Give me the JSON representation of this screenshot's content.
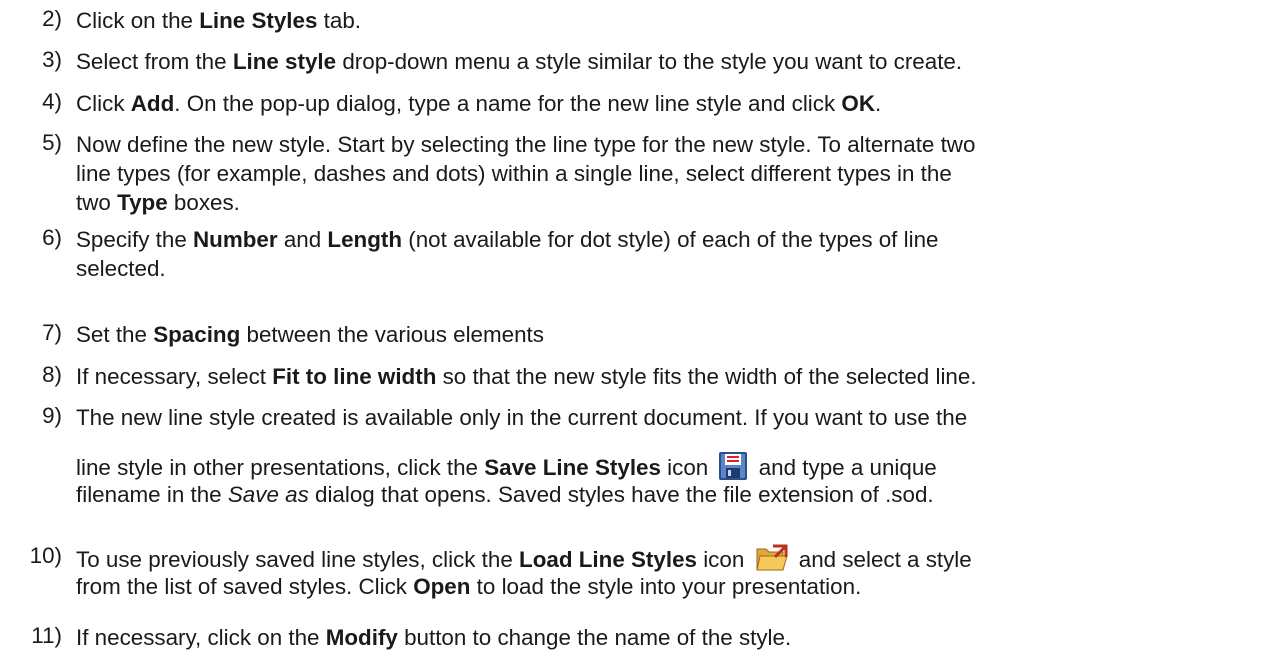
{
  "steps": [
    {
      "num": "2)",
      "lines": [
        [
          {
            "t": "Click on the "
          },
          {
            "t": "Line Styles",
            "b": true
          },
          {
            "t": " tab."
          }
        ]
      ]
    },
    {
      "num": "3)",
      "lines": [
        [
          {
            "t": "Select from the "
          },
          {
            "t": "Line style",
            "b": true
          },
          {
            "t": " drop-down menu a style similar to the style you want to create."
          }
        ]
      ]
    },
    {
      "num": "4)",
      "lines": [
        [
          {
            "t": "Click "
          },
          {
            "t": "Add",
            "b": true
          },
          {
            "t": ". On the pop-up dialog, type a name for the new line style and click "
          },
          {
            "t": "OK",
            "b": true
          },
          {
            "t": "."
          }
        ]
      ]
    },
    {
      "num": "5)",
      "lines": [
        [
          {
            "t": "Now define the new style. Start by selecting the line type for the new style. To alternate two"
          }
        ],
        [
          {
            "t": "line types (for example, dashes and dots) within a single line, select different types in the"
          }
        ],
        [
          {
            "t": "two "
          },
          {
            "t": "Type",
            "b": true
          },
          {
            "t": " boxes."
          }
        ]
      ]
    },
    {
      "num": "6)",
      "lines": [
        [
          {
            "t": "Specify the "
          },
          {
            "t": "Number",
            "b": true
          },
          {
            "t": " and "
          },
          {
            "t": "Length",
            "b": true
          },
          {
            "t": " (not available for dot style) of each of the types of line"
          }
        ],
        [
          {
            "t": "selected."
          }
        ]
      ]
    },
    {
      "num": "7)",
      "lines": [
        [
          {
            "t": "Set the "
          },
          {
            "t": "Spacing",
            "b": true
          },
          {
            "t": " between the various elements"
          }
        ]
      ]
    },
    {
      "num": "8)",
      "lines": [
        [
          {
            "t": "If necessary, select "
          },
          {
            "t": "Fit to line width",
            "b": true
          },
          {
            "t": " so that the new style fits the width of the selected line."
          }
        ]
      ]
    },
    {
      "num": "9)",
      "lines": [
        [
          {
            "t": "The new line style created is available only in the current document. If you want to use the"
          }
        ],
        [
          {
            "t": "line style in other presentations, click the "
          },
          {
            "t": "Save Line Styles",
            "b": true
          },
          {
            "t": " icon "
          },
          {
            "icon": "save-icon"
          },
          {
            "t": " and type a unique"
          }
        ],
        [
          {
            "t": "filename in the "
          },
          {
            "t": "Save as",
            "i": true
          },
          {
            "t": " dialog that opens. Saved styles have the file extension of .sod."
          }
        ]
      ]
    },
    {
      "num": "10)",
      "lines": [
        [
          {
            "t": "To use previously saved line styles, click the "
          },
          {
            "t": "Load Line Styles",
            "b": true
          },
          {
            "t": " icon "
          },
          {
            "icon": "open-folder-icon"
          },
          {
            "t": " and select a style"
          }
        ],
        [
          {
            "t": "from the list of saved styles. Click "
          },
          {
            "t": "Open",
            "b": true
          },
          {
            "t": " to load the style into your presentation."
          }
        ]
      ]
    },
    {
      "num": "11)",
      "lines": [
        [
          {
            "t": "If necessary, click on the "
          },
          {
            "t": "Modify",
            "b": true
          },
          {
            "t": " button to change the name of the style."
          }
        ]
      ]
    }
  ]
}
